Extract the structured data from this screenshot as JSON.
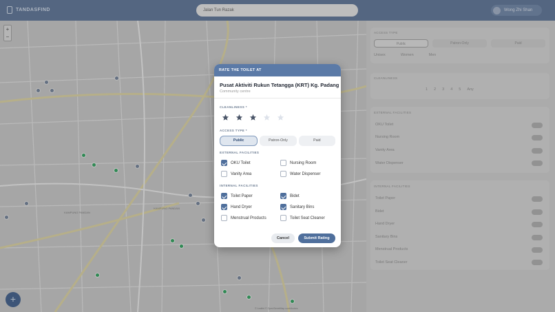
{
  "app": {
    "name": "TANDASFIND"
  },
  "search": {
    "placeholder": "Jalan Tun Razak"
  },
  "user": {
    "name": "Wong Zhi Shan"
  },
  "map": {
    "zoom_in": "+",
    "zoom_out": "−",
    "labels": {
      "kampung_pandan_1": "KAMPUNG PANDAN",
      "kampung_pandan_2": "KAMPUNG PANDAN"
    },
    "attribution": "© Leaflet © OpenStreetMap contributors"
  },
  "fab": {
    "label": "+"
  },
  "panel": {
    "access_type_label": "ACCESS TYPE",
    "access_tabs": [
      "Public",
      "Patron-Only",
      "Paid"
    ],
    "access_checks": [
      "Unisex",
      "Women",
      "Men"
    ],
    "cleanliness_label": "CLEANLINESS",
    "cleanliness_values": [
      "1",
      "2",
      "3",
      "4",
      "5",
      "Any"
    ],
    "external_label": "EXTERNAL FACILITIES",
    "external_items": [
      "OKU Toilet",
      "Nursing Room",
      "Vanity Area",
      "Water Dispenser"
    ],
    "internal_label": "INTERNAL FACILITIES",
    "internal_items": [
      "Toilet Paper",
      "Bidet",
      "Hand Dryer",
      "Sanitary Bins",
      "Menstrual Products",
      "Toilet Seat Cleaner"
    ]
  },
  "modal": {
    "header": "RATE THE TOILET AT",
    "title": "Pusat Aktiviti Rukun Tetangga (KRT) Kg. Padang",
    "subtitle": "Community centre",
    "cleanliness": {
      "label": "CLEANLINESS *",
      "rating": 3,
      "max": 5
    },
    "access_type": {
      "label": "ACCESS TYPE *",
      "options": [
        "Public",
        "Patron-Only",
        "Paid"
      ],
      "selected": "Public"
    },
    "external": {
      "label": "EXTERNAL FACILITIES",
      "items": [
        {
          "label": "OKU Toilet",
          "checked": true
        },
        {
          "label": "Nursing Room",
          "checked": false
        },
        {
          "label": "Vanity Area",
          "checked": false
        },
        {
          "label": "Water Dispenser",
          "checked": false
        }
      ]
    },
    "internal": {
      "label": "INTERNAL FACILITIES",
      "items": [
        {
          "label": "Toilet Paper",
          "checked": true
        },
        {
          "label": "Bidet",
          "checked": true
        },
        {
          "label": "Hand Dryer",
          "checked": true
        },
        {
          "label": "Sanitary Bins",
          "checked": true
        },
        {
          "label": "Menstrual Products",
          "checked": false
        },
        {
          "label": "Toilet Seat Cleaner",
          "checked": false
        }
      ]
    },
    "cancel_label": "Cancel",
    "submit_label": "Submit Rating"
  },
  "colors": {
    "accent": "#4f6f9c",
    "header": "#5b7aa7",
    "star_on": "#4a5568",
    "star_off": "#dde2ea"
  }
}
